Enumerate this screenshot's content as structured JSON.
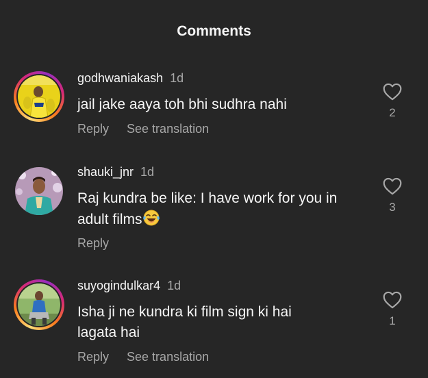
{
  "header": {
    "title": "Comments"
  },
  "comments": [
    {
      "username": "godhwaniakash",
      "time": "1d",
      "text": "jail jake aaya toh bhi sudhra nahi",
      "likes": "2",
      "reply_label": "Reply",
      "translate_label": "See translation",
      "story_ring": true
    },
    {
      "username": "shauki_jnr",
      "time": "1d",
      "text": "Raj kundra be like: I have work for you in adult films",
      "likes": "3",
      "reply_label": "Reply",
      "story_ring": false
    },
    {
      "username": "suyogindulkar4",
      "time": "1d",
      "text_line1": "Isha ji ne kundra ki film sign ki hai",
      "text_line2": "lagata hai",
      "likes": "1",
      "reply_label": "Reply",
      "translate_label": "See translation",
      "story_ring": true
    }
  ],
  "icons": {
    "like": "heart-outline-icon",
    "emoji": "laughing-tears-emoji"
  },
  "colors": {
    "background": "#262626",
    "primary_text": "#f5f5f5",
    "secondary_text": "#a8a8a8"
  }
}
